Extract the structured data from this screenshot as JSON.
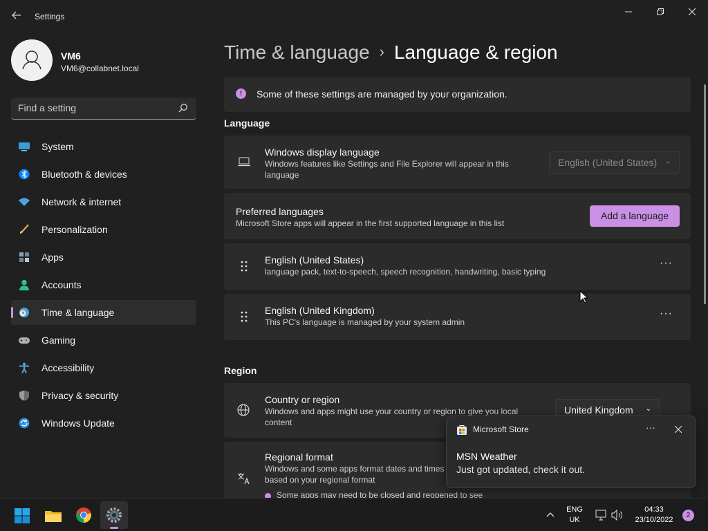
{
  "window": {
    "app_title": "Settings",
    "back_icon": "arrow-left-icon",
    "controls": [
      "minimize-icon",
      "restore-icon",
      "close-icon"
    ]
  },
  "profile": {
    "name": "VM6",
    "email": "VM6@collabnet.local"
  },
  "search": {
    "placeholder": "Find a setting"
  },
  "sidebar": {
    "items": [
      {
        "label": "System",
        "icon": "monitor-icon",
        "color": "#3a9bd9"
      },
      {
        "label": "Bluetooth & devices",
        "icon": "bluetooth-icon",
        "color": "#0a84ff"
      },
      {
        "label": "Network & internet",
        "icon": "wifi-icon",
        "color": "#4aa3df"
      },
      {
        "label": "Personalization",
        "icon": "brush-icon",
        "color": "#e0a458"
      },
      {
        "label": "Apps",
        "icon": "apps-grid-icon",
        "color": "#8da3b5"
      },
      {
        "label": "Accounts",
        "icon": "person-icon",
        "color": "#2fbf8e"
      },
      {
        "label": "Time & language",
        "icon": "globe-clock-icon",
        "color": "#4aa3df",
        "active": true
      },
      {
        "label": "Gaming",
        "icon": "gamepad-icon",
        "color": "#b0b0b0"
      },
      {
        "label": "Accessibility",
        "icon": "accessibility-icon",
        "color": "#4aa3df"
      },
      {
        "label": "Privacy & security",
        "icon": "shield-icon",
        "color": "#9a9a9a"
      },
      {
        "label": "Windows Update",
        "icon": "update-icon",
        "color": "#2f8fd8"
      }
    ]
  },
  "breadcrumb": {
    "parent": "Time & language",
    "separator": "›",
    "current": "Language & region"
  },
  "org_notice": "Some of these settings are managed by your organization.",
  "language": {
    "section_title": "Language",
    "display": {
      "title": "Windows display language",
      "subtitle": "Windows features like Settings and File Explorer will appear in this language",
      "value": "English (United States)"
    },
    "preferred": {
      "title": "Preferred languages",
      "subtitle": "Microsoft Store apps will appear in the first supported language in this list",
      "button": "Add a language"
    },
    "list": [
      {
        "title": "English (United States)",
        "subtitle": "language pack, text-to-speech, speech recognition, handwriting, basic typing"
      },
      {
        "title": "English (United Kingdom)",
        "subtitle": "This PC's language is managed by your system admin"
      }
    ],
    "more_glyph": "···"
  },
  "region": {
    "section_title": "Region",
    "country": {
      "title": "Country or region",
      "subtitle": "Windows and apps might use your country or region to give you local content",
      "value": "United Kingdom"
    },
    "format": {
      "title": "Regional format",
      "subtitle": "Windows and some apps format dates and times based on your regional format",
      "note": "Some apps may need to be closed and reopened to see"
    }
  },
  "toast": {
    "app": "Microsoft Store",
    "title": "MSN Weather",
    "body": "Just got updated, check it out.",
    "more_glyph": "···"
  },
  "taskbar": {
    "apps": [
      "windows-start-icon",
      "file-explorer-icon",
      "chrome-icon",
      "settings-gear-icon"
    ],
    "lang_top": "ENG",
    "lang_bottom": "UK",
    "time": "04:33",
    "date": "23/10/2022",
    "notification_count": "2"
  },
  "colors": {
    "accent": "#c990e5",
    "background": "#202020",
    "card": "#2b2b2b",
    "taskbar": "#1c1c1c"
  }
}
